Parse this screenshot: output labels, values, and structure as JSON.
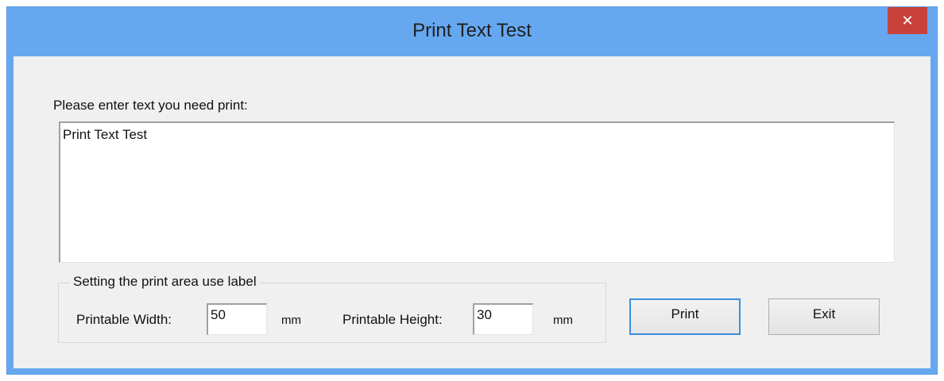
{
  "window": {
    "title": "Print Text Test",
    "close_glyph": "✕"
  },
  "form": {
    "prompt_label": "Please enter text you need print:",
    "text_value": "Print Text Test",
    "group_title": "Setting the print area use label",
    "width_label": "Printable Width:",
    "width_value": "50",
    "width_unit": "mm",
    "height_label": "Printable Height:",
    "height_value": "30",
    "height_unit": "mm"
  },
  "buttons": {
    "print_label": "Print",
    "exit_label": "Exit"
  },
  "colors": {
    "title_bar": "#66a8f0",
    "close_button": "#c8423b",
    "client_background": "#f0f0f0",
    "default_button_border": "#3c8fdc"
  },
  "icons": {
    "close": "close-icon"
  }
}
